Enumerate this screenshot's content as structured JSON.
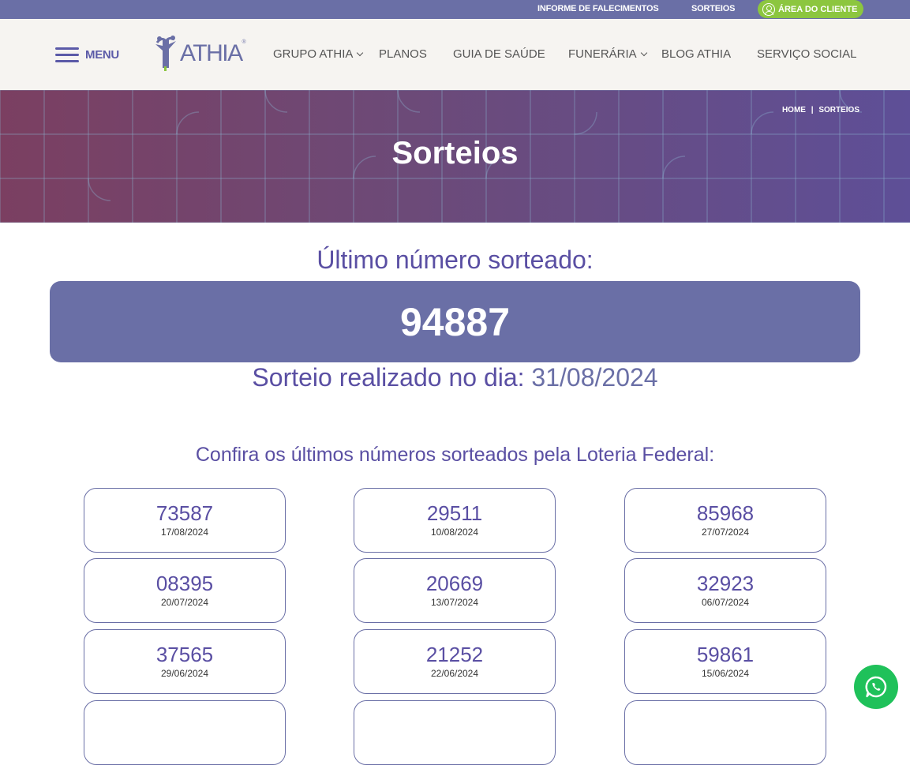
{
  "topbar": {
    "falecimentos": "INFORME DE FALECIMENTOS",
    "sorteios": "SORTEIOS",
    "area_cliente": "ÁREA DO CLIENTE"
  },
  "nav": {
    "menu_label": "MENU",
    "logo_text": "ATHIA",
    "logo_reg": "®",
    "items": [
      {
        "label": "GRUPO ATHIA"
      },
      {
        "label": "PLANOS"
      },
      {
        "label": "GUIA DE SAÚDE"
      },
      {
        "label": "FUNERÁRIA"
      },
      {
        "label": "BLOG ATHIA"
      },
      {
        "label": "SERVIÇO SOCIAL"
      }
    ]
  },
  "hero": {
    "breadcrumb_home": "HOME",
    "breadcrumb_sep": "|",
    "breadcrumb_current": "SORTEIOS",
    "title": "Sorteios"
  },
  "main": {
    "last_label": "Último número sorteado:",
    "last_number": "94887",
    "sorteio_prefix": "Sorteio realizado no dia:",
    "sorteio_date": "31/08/2024",
    "confira": "Confira os últimos números sorteados pela Loteria Federal:",
    "draws": [
      {
        "number": "73587",
        "date": "17/08/2024"
      },
      {
        "number": "29511",
        "date": "10/08/2024"
      },
      {
        "number": "85968",
        "date": "27/07/2024"
      },
      {
        "number": "08395",
        "date": "20/07/2024"
      },
      {
        "number": "20669",
        "date": "13/07/2024"
      },
      {
        "number": "32923",
        "date": "06/07/2024"
      },
      {
        "number": "37565",
        "date": "29/06/2024"
      },
      {
        "number": "21252",
        "date": "22/06/2024"
      },
      {
        "number": "59861",
        "date": "15/06/2024"
      }
    ]
  },
  "colors": {
    "primary": "#6a6fa6",
    "text_purple": "#5a4fa3",
    "green": "#8cc63f",
    "whatsapp": "#1fc15a"
  }
}
